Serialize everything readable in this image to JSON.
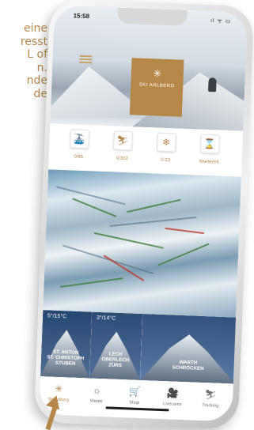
{
  "background_text": [
    "eine",
    "resst",
    "L of",
    "n.",
    "nde",
    "de"
  ],
  "status_bar": {
    "time": "15:58",
    "icons": "ıl ᯤ ▭"
  },
  "header": {
    "logo_text": "SKI ARLBERG"
  },
  "stats": [
    {
      "icon": "gondola-icon",
      "glyph": "🚠",
      "value": "0/85"
    },
    {
      "icon": "slope-icon",
      "glyph": "⛷",
      "value": "0/302"
    },
    {
      "icon": "snow-icon",
      "glyph": "❄",
      "value": "0-23"
    },
    {
      "icon": "hourglass-icon",
      "glyph": "⌛",
      "value": "Wartezeit"
    }
  ],
  "villages": [
    {
      "name": "ST. ANTON\nST. CHRISTOPH\nSTUBEN",
      "weather": "5°/15°C",
      "color": "#2f4f78"
    },
    {
      "name": "LECH\nOBERLECH\nZÜRS",
      "weather": "3°/14°C",
      "color": "#36557d"
    },
    {
      "name": "WARTH\nSCHRÖCKEN",
      "weather": "",
      "color": "#3e5f86"
    }
  ],
  "tabs": [
    {
      "label": "Ski Arlberg",
      "icon": "ski-arlberg-icon",
      "glyph": "✳",
      "active": true
    },
    {
      "label": "Wetter",
      "icon": "weather-icon",
      "glyph": "☼",
      "active": false
    },
    {
      "label": "Shop",
      "icon": "cart-icon",
      "glyph": "🛒",
      "active": false
    },
    {
      "label": "Livecams",
      "icon": "camera-icon",
      "glyph": "🎥",
      "active": false
    },
    {
      "label": "Tracking",
      "icon": "tracking-icon",
      "glyph": "⛷",
      "active": false
    }
  ],
  "colors": {
    "accent": "#b5884a",
    "tab_inactive": "#6f6f6f"
  }
}
